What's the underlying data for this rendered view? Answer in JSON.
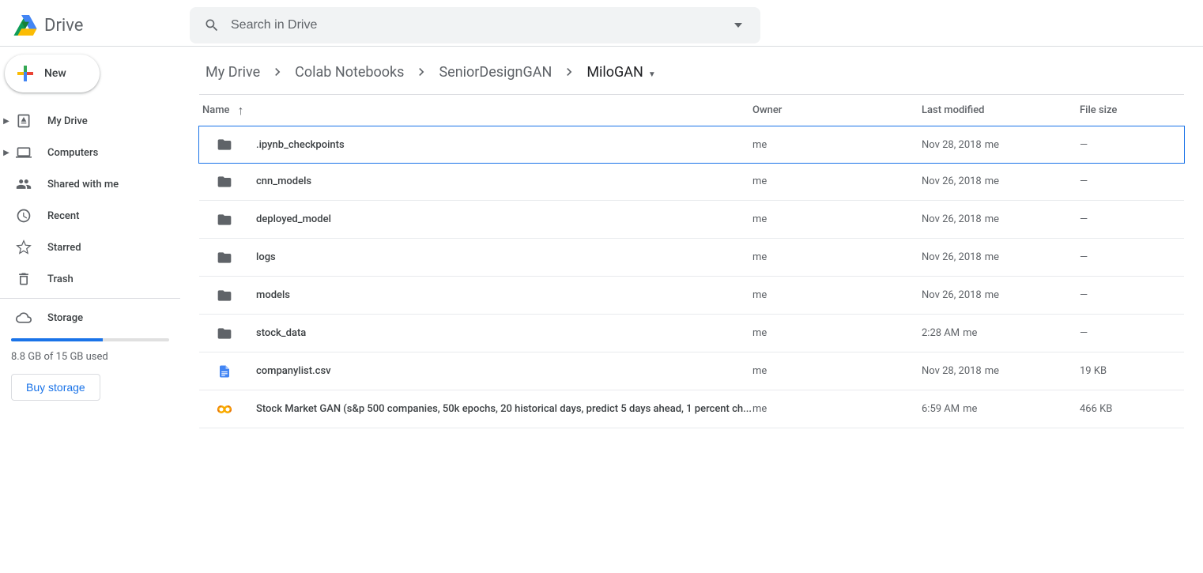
{
  "app": {
    "name": "Drive"
  },
  "search": {
    "placeholder": "Search in Drive"
  },
  "sidebar": {
    "new_label": "New",
    "items": [
      {
        "label": "My Drive",
        "icon": "drive",
        "expandable": true
      },
      {
        "label": "Computers",
        "icon": "computers",
        "expandable": true
      },
      {
        "label": "Shared with me",
        "icon": "shared",
        "expandable": false
      },
      {
        "label": "Recent",
        "icon": "recent",
        "expandable": false
      },
      {
        "label": "Starred",
        "icon": "star",
        "expandable": false
      },
      {
        "label": "Trash",
        "icon": "trash",
        "expandable": false
      }
    ],
    "storage_label": "Storage",
    "storage_used": "8.8 GB of 15 GB used",
    "storage_percent": 58,
    "buy_label": "Buy storage"
  },
  "breadcrumbs": [
    {
      "label": "My Drive"
    },
    {
      "label": "Colab Notebooks"
    },
    {
      "label": "SeniorDesignGAN"
    },
    {
      "label": "MiloGAN"
    }
  ],
  "columns": {
    "name": "Name",
    "owner": "Owner",
    "modified": "Last modified",
    "size": "File size"
  },
  "files": [
    {
      "name": ".ipynb_checkpoints",
      "type": "folder",
      "owner": "me",
      "modified": "Nov 28, 2018",
      "modified_by": "me",
      "size": "—",
      "selected": true
    },
    {
      "name": "cnn_models",
      "type": "folder",
      "owner": "me",
      "modified": "Nov 26, 2018",
      "modified_by": "me",
      "size": "—"
    },
    {
      "name": "deployed_model",
      "type": "folder",
      "owner": "me",
      "modified": "Nov 26, 2018",
      "modified_by": "me",
      "size": "—"
    },
    {
      "name": "logs",
      "type": "folder",
      "owner": "me",
      "modified": "Nov 26, 2018",
      "modified_by": "me",
      "size": "—"
    },
    {
      "name": "models",
      "type": "folder",
      "owner": "me",
      "modified": "Nov 26, 2018",
      "modified_by": "me",
      "size": "—"
    },
    {
      "name": "stock_data",
      "type": "folder",
      "owner": "me",
      "modified": "2:28 AM",
      "modified_by": "me",
      "size": "—"
    },
    {
      "name": "companylist.csv",
      "type": "sheet",
      "owner": "me",
      "modified": "Nov 28, 2018",
      "modified_by": "me",
      "size": "19 KB"
    },
    {
      "name": "Stock Market GAN (s&p 500 companies, 50k epochs, 20 historical days, predict 5 days ahead, 1 percent ch...",
      "type": "colab",
      "owner": "me",
      "modified": "6:59 AM",
      "modified_by": "me",
      "size": "466 KB"
    }
  ]
}
